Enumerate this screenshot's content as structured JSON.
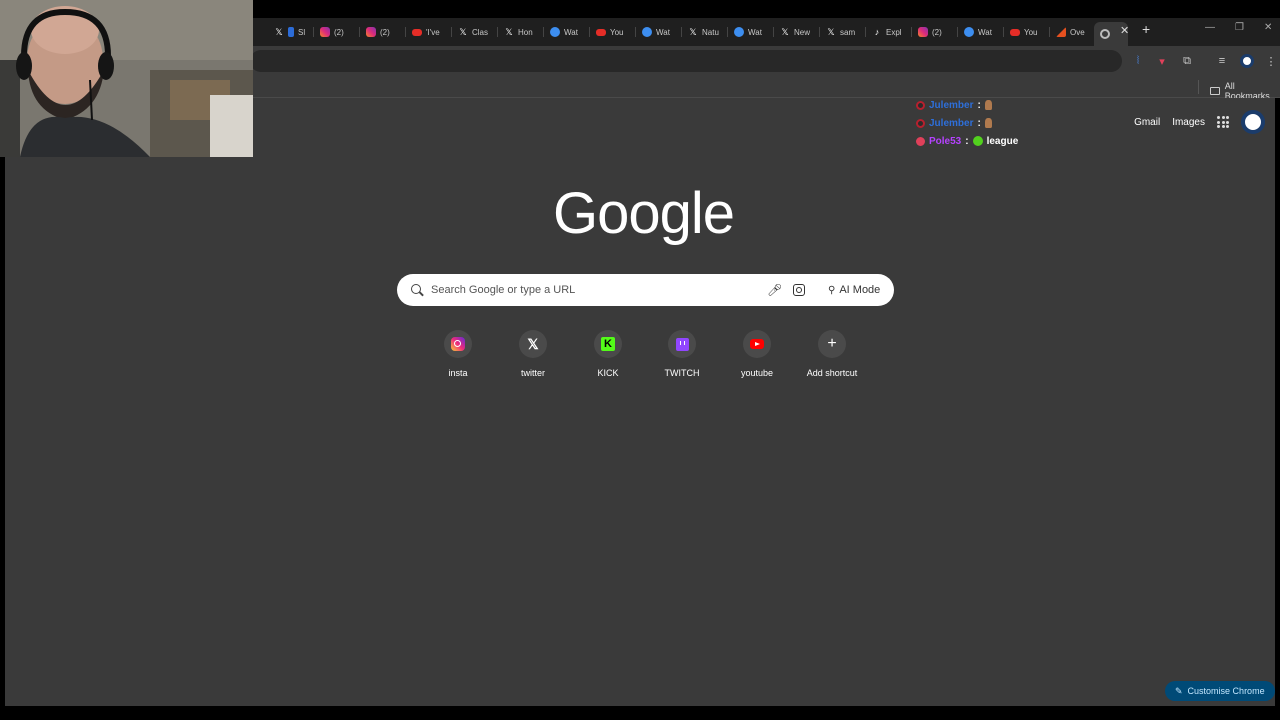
{
  "tabs": [
    {
      "icon": "slack",
      "title": "Sl"
    },
    {
      "icon": "instagram",
      "title": "(2)"
    },
    {
      "icon": "instagram",
      "title": "(2)"
    },
    {
      "icon": "youtube",
      "title": "'I've"
    },
    {
      "icon": "x",
      "title": "Clas"
    },
    {
      "icon": "x",
      "title": "Hon"
    },
    {
      "icon": "ai",
      "title": "Wat"
    },
    {
      "icon": "youtube",
      "title": "You"
    },
    {
      "icon": "ai",
      "title": "Wat"
    },
    {
      "icon": "x",
      "title": "Natu"
    },
    {
      "icon": "ai",
      "title": "Wat"
    },
    {
      "icon": "x",
      "title": "New"
    },
    {
      "icon": "x",
      "title": "sam"
    },
    {
      "icon": "tiktok",
      "title": "Expl"
    },
    {
      "icon": "instagram",
      "title": "(2)"
    },
    {
      "icon": "ai",
      "title": "Wat"
    },
    {
      "icon": "youtube",
      "title": "You"
    },
    {
      "icon": "overleaf",
      "title": "Ove"
    }
  ],
  "bookmarks": {
    "all_label": "All Bookmarks"
  },
  "header": {
    "gmail": "Gmail",
    "images": "Images"
  },
  "logo": "Google",
  "search": {
    "placeholder": "Search Google or type a URL",
    "ai_mode": "AI Mode"
  },
  "shortcuts": [
    {
      "label": "insta",
      "icon": "instagram-icon"
    },
    {
      "label": "twitter",
      "icon": "x-icon"
    },
    {
      "label": "KICK",
      "icon": "kick-icon"
    },
    {
      "label": "TWITCH",
      "icon": "twitch-icon"
    },
    {
      "label": "youtube",
      "icon": "youtube-icon"
    },
    {
      "label": "Add shortcut",
      "icon": "plus-icon"
    }
  ],
  "customise": "Customise Chrome",
  "chat": [
    {
      "user": "Julember",
      "message": ""
    },
    {
      "user": "Julember",
      "message": ""
    },
    {
      "user": "Pole53",
      "message": "league"
    }
  ],
  "colors": {
    "ntp_bg": "#3a3a3a",
    "tabstrip_bg": "#1f1f1f",
    "customise_bg": "#004a77",
    "customise_text": "#c2e7ff"
  }
}
